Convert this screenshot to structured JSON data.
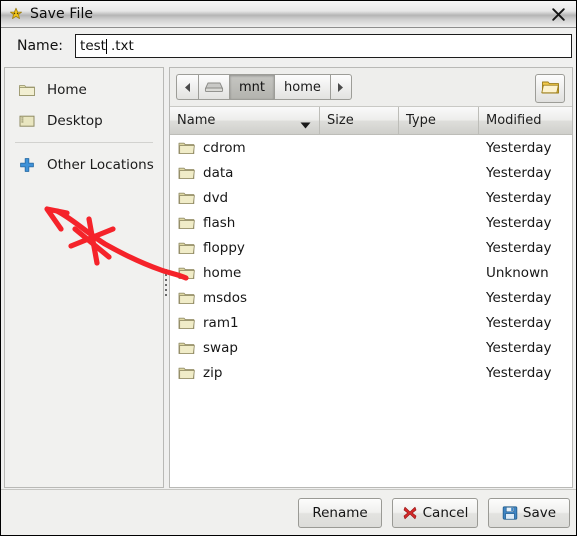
{
  "window": {
    "title": "Save File",
    "title_icon": "app-star-icon",
    "close_icon": "close-icon"
  },
  "name_row": {
    "label": "Name:",
    "value": "test.txt",
    "caret_after": "test"
  },
  "sidebar": {
    "items": [
      {
        "label": "Home",
        "icon": "folder-icon"
      },
      {
        "label": "Desktop",
        "icon": "desktop-icon"
      },
      {
        "label": "Other Locations",
        "icon": "plus-icon"
      }
    ]
  },
  "pathbar": {
    "back_icon": "chevron-left-icon",
    "drive_icon": "drive-icon",
    "crumbs": [
      {
        "label": "mnt",
        "active": true
      },
      {
        "label": "home",
        "active": false
      }
    ],
    "forward_icon": "chevron-right-icon",
    "new_folder_icon": "new-folder-icon",
    "new_folder_label": ""
  },
  "file_list": {
    "columns": [
      {
        "label": "Name",
        "sorted": true,
        "sort_icon": "sort-desc-icon"
      },
      {
        "label": "Size",
        "sorted": false
      },
      {
        "label": "Type",
        "sorted": false
      },
      {
        "label": "Modified",
        "sorted": false
      }
    ],
    "rows": [
      {
        "name": "cdrom",
        "size": "",
        "type": "",
        "modified": "Yesterday",
        "icon": "folder-icon"
      },
      {
        "name": "data",
        "size": "",
        "type": "",
        "modified": "Yesterday",
        "icon": "folder-icon"
      },
      {
        "name": "dvd",
        "size": "",
        "type": "",
        "modified": "Yesterday",
        "icon": "folder-icon"
      },
      {
        "name": "flash",
        "size": "",
        "type": "",
        "modified": "Yesterday",
        "icon": "folder-icon"
      },
      {
        "name": "floppy",
        "size": "",
        "type": "",
        "modified": "Yesterday",
        "icon": "folder-icon"
      },
      {
        "name": "home",
        "size": "",
        "type": "",
        "modified": "Unknown",
        "icon": "folder-icon"
      },
      {
        "name": "msdos",
        "size": "",
        "type": "",
        "modified": "Yesterday",
        "icon": "folder-icon"
      },
      {
        "name": "ram1",
        "size": "",
        "type": "",
        "modified": "Yesterday",
        "icon": "folder-icon"
      },
      {
        "name": "swap",
        "size": "",
        "type": "",
        "modified": "Yesterday",
        "icon": "folder-icon"
      },
      {
        "name": "zip",
        "size": "",
        "type": "",
        "modified": "Yesterday",
        "icon": "folder-icon"
      }
    ]
  },
  "buttons": {
    "rename": "Rename",
    "cancel": "Cancel",
    "cancel_icon": "red-x-icon",
    "save": "Save",
    "save_icon": "floppy-disk-icon"
  },
  "annotation": {
    "color": "#f5232a",
    "shape": "arrow-with-cross-mark",
    "points_to": "home"
  },
  "colors": {
    "accent_red": "#f5232a",
    "folder_yellow": "#e8e1a8",
    "plus_blue": "#3b8fd4",
    "window_bg": "#f0f0ef"
  }
}
